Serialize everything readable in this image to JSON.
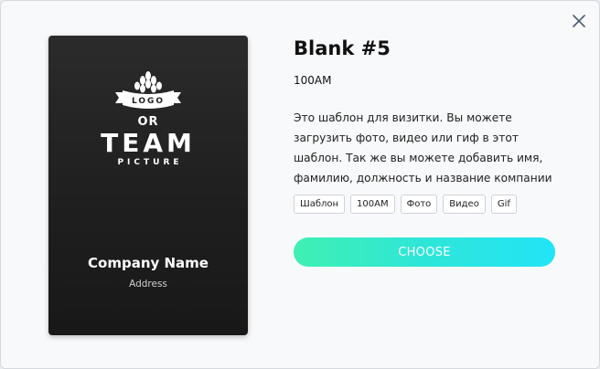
{
  "modal": {
    "close_icon": "close-icon"
  },
  "preview_card": {
    "logo": {
      "emblem_text": "LOGO",
      "or_text": "OR",
      "team_text": "TEAM",
      "picture_text": "PICTURE"
    },
    "company_name": "Company Name",
    "address": "Address",
    "colors": {
      "background": "#222222",
      "text": "#ffffff"
    }
  },
  "template": {
    "title": "Blank #5",
    "subtitle": "100AM",
    "description": "Это шаблон для визитки. Вы можете загрузить фото, видео или гиф в этот шаблон. Так же вы можете добавить имя, фамилию, должность и название компании",
    "tags": [
      "Шаблон",
      "100AM",
      "Фото",
      "Видео",
      "Gif"
    ]
  },
  "actions": {
    "choose_label": "CHOOSE",
    "choose_gradient": [
      "#3ff0b2",
      "#22e4f7"
    ]
  }
}
